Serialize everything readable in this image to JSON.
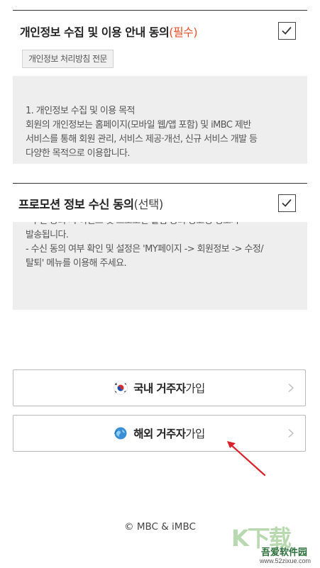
{
  "privacy_section": {
    "title": "개인정보 수집 및 이용 안내 동의",
    "required_tag": "(필수)",
    "checked": true,
    "policy_button_label": "개인정보 처리방침 전문",
    "terms_lines": [
      "1. 개인정보 수집 및 이용 목적",
      "회원의 개인정보는 홈페이지(모바일 웹/앱 포함) 및 iMBC 제반",
      "서비스를 통해 회원 관리, 서비스 제공·개선, 신규 서비스 개발 등",
      "다양한 목적으로 이용합니다."
    ]
  },
  "promo_section": {
    "title": "프로모션 정보 수신 동의",
    "optional_tag": "(선택)",
    "checked": true,
    "terms_lines": [
      "- 수신 동의 시 이벤트 및 프로모션 알림 등의 광고성 정보가",
      "발송됩니다.",
      "- 수신 동의 여부 확인 및 설정은 'MY페이지 -> 회원정보 -> 수정/",
      "탈퇴' 메뉴를 이용해 주세요."
    ]
  },
  "join_buttons": {
    "domestic": {
      "bold": "국내 거주자",
      "light": "가입",
      "icon": "korea-flag-icon"
    },
    "overseas": {
      "bold": "해외 거주자",
      "light": "가입",
      "icon": "globe-icon"
    }
  },
  "annotation_arrow_color": "#d9232a",
  "footer": {
    "copyright": "© MBC & iMBC"
  },
  "watermark": {
    "name": "吾爱软件园",
    "url": "www.52zixue.com"
  }
}
